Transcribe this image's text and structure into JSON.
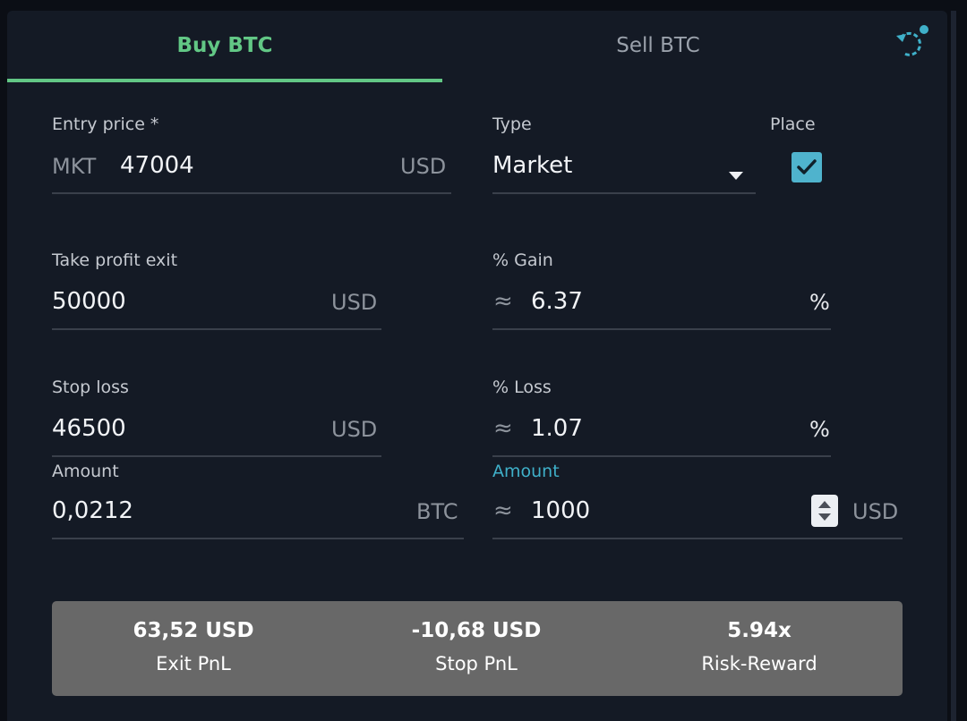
{
  "tabs": {
    "buy": "Buy BTC",
    "sell": "Sell BTC",
    "active": "buy"
  },
  "icons": {
    "reset": "refresh-icon",
    "dropdown": "caret-down-icon",
    "check": "checkmark-icon",
    "spinner": "stepper-icon"
  },
  "colors": {
    "accent_green": "#62c785",
    "accent_teal": "#4fb3cd",
    "panel": "#141a25",
    "summary_bg": "#686868"
  },
  "entry": {
    "label": "Entry price *",
    "prefix": "MKT",
    "value": "47004",
    "unit": "USD"
  },
  "type": {
    "label": "Type",
    "value": "Market"
  },
  "place": {
    "label": "Place",
    "checked": true
  },
  "take_profit": {
    "label": "Take profit exit",
    "value": "50000",
    "unit": "USD"
  },
  "gain": {
    "label": "% Gain",
    "approx": "≈",
    "value": "6.37",
    "unit": "%"
  },
  "stop_loss": {
    "label": "Stop loss",
    "value": "46500",
    "unit": "USD"
  },
  "loss": {
    "label": "% Loss",
    "approx": "≈",
    "value": "1.07",
    "unit": "%"
  },
  "amount_btc": {
    "label": "Amount",
    "value": "0,0212",
    "unit": "BTC"
  },
  "amount_usd": {
    "label": "Amount",
    "approx": "≈",
    "value": "1000",
    "unit": "USD"
  },
  "summary": {
    "exit": {
      "value": "63,52 USD",
      "label": "Exit PnL"
    },
    "stop": {
      "value": "-10,68 USD",
      "label": "Stop PnL"
    },
    "rr": {
      "value": "5.94x",
      "label": "Risk-Reward"
    }
  }
}
